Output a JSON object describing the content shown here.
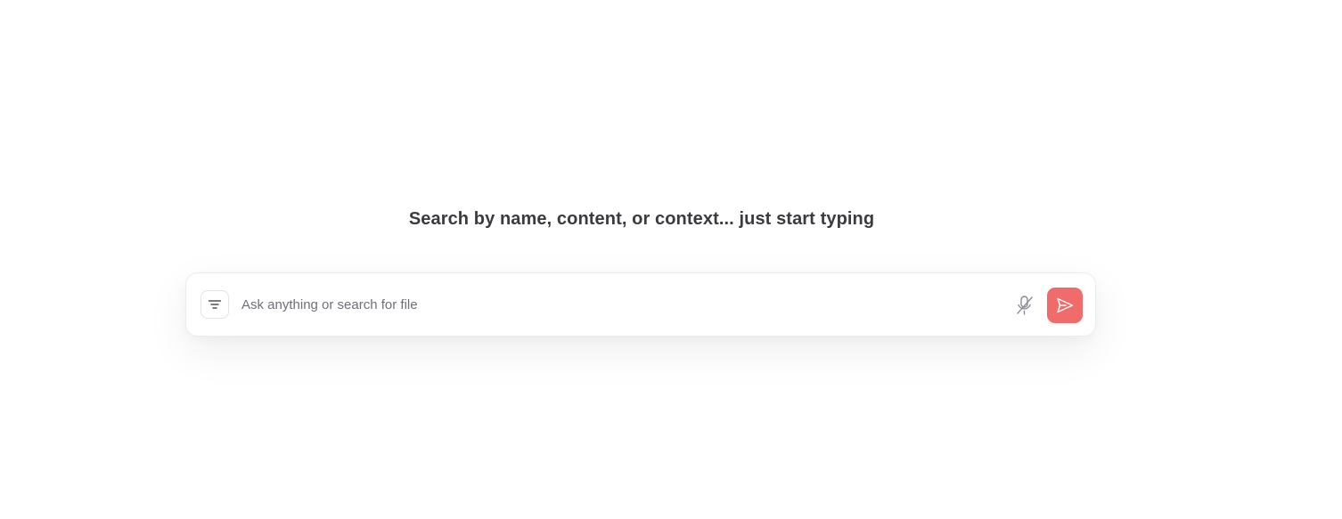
{
  "headline": "Search by name, content, or context... just start typing",
  "search": {
    "placeholder": "Ask anything or search for file",
    "value": ""
  },
  "icons": {
    "filter": "filter-lines-icon",
    "mic": "microphone-off-icon",
    "send": "paper-plane-send-icon"
  },
  "colors": {
    "accent": "#f16b6b",
    "headline": "#3b3b3f",
    "placeholder": "#6f6f78"
  }
}
